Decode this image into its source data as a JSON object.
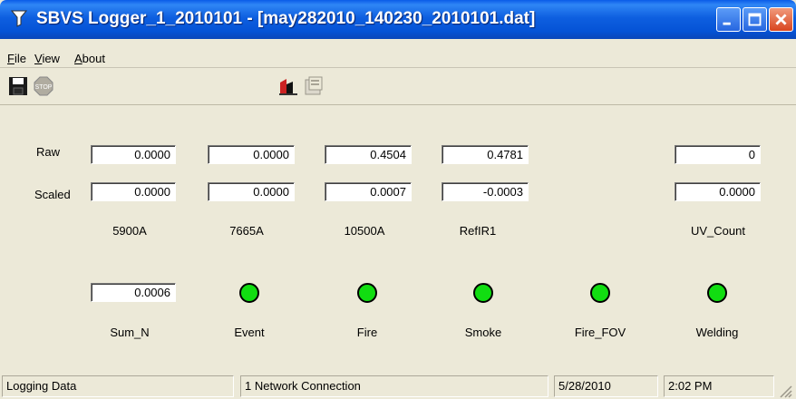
{
  "window": {
    "title": "SBVS Logger_1_2010101 - [may282010_140230_2010101.dat]",
    "app_icon": "funnel-icon"
  },
  "menu": {
    "file": "File",
    "view": "View",
    "about": "About"
  },
  "toolbar": {
    "save_icon": "floppy-disk-icon",
    "stop_icon": "stop-icon",
    "plot_icon": "chart-icon",
    "properties_icon": "properties-icon"
  },
  "rows": {
    "raw_label": "Raw",
    "scaled_label": "Scaled"
  },
  "channels": [
    {
      "name": "5900A",
      "raw": "0.0000",
      "scaled": "0.0000"
    },
    {
      "name": "7665A",
      "raw": "0.0000",
      "scaled": "0.0000"
    },
    {
      "name": "10500A",
      "raw": "0.4504",
      "scaled": "0.0007"
    },
    {
      "name": "RefIR1",
      "raw": "0.4781",
      "scaled": "-0.0003"
    },
    {
      "name": "UV_Count",
      "raw": "0",
      "scaled": "0.0000"
    }
  ],
  "sum": {
    "label": "Sum_N",
    "value": "0.0006"
  },
  "indicators": [
    {
      "label": "Event",
      "state": "on",
      "color": "#11dd11"
    },
    {
      "label": "Fire",
      "state": "on",
      "color": "#11dd11"
    },
    {
      "label": "Smoke",
      "state": "on",
      "color": "#11dd11"
    },
    {
      "label": "Fire_FOV",
      "state": "on",
      "color": "#11dd11"
    },
    {
      "label": "Welding",
      "state": "on",
      "color": "#11dd11"
    }
  ],
  "status": {
    "message": "Logging Data",
    "connection": "1 Network Connection",
    "date": "5/28/2010",
    "time": "2:02 PM"
  }
}
